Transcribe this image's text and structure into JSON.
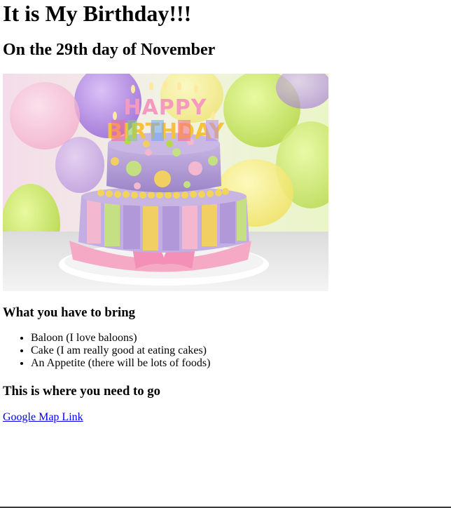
{
  "page": {
    "title": "It is My Birthday!!!",
    "subtitle": "On the 29th day of November"
  },
  "image": {
    "cake_topper_text_line1": "HAPPY",
    "cake_topper_text_line2": "BIRTHDAY",
    "colors": {
      "cake_top": "#b9a2d6",
      "cake_bottom_stripe_pink": "#f3b8cf",
      "cake_bottom_stripe_yellow": "#f2cf63",
      "cake_bottom_stripe_purple": "#b198d9",
      "cake_bottom_stripe_green": "#c5df83",
      "ribbon": "#f6a9c4",
      "balloon_green": "#c6e85a",
      "balloon_purple": "#b58ae6",
      "balloon_pink": "#f6bcd3"
    }
  },
  "bring": {
    "heading": "What you have to bring",
    "items": [
      "Baloon (I love baloons)",
      "Cake (I am really good at eating cakes)",
      "An Appetite (there will be lots of foods)"
    ]
  },
  "location": {
    "heading": "This is where you need to go",
    "link_text": "Google Map Link"
  }
}
